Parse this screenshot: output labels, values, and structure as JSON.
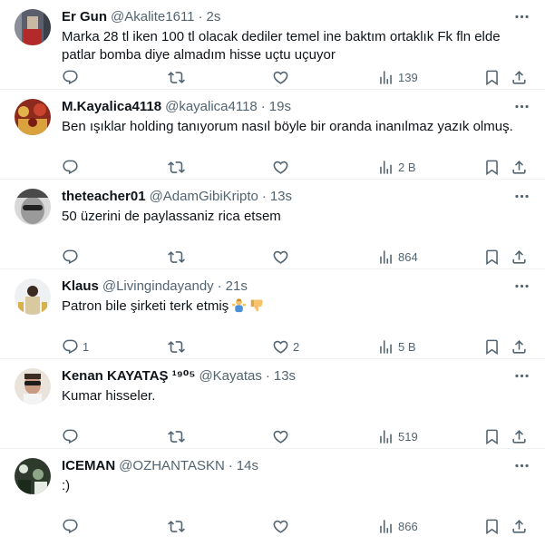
{
  "tweets": [
    {
      "name": "Er Gun",
      "handle": "@Akalite1611",
      "time": "2s",
      "text": "Marka 28 tl iken 100 tl olacak dediler temel ine baktım ortaklık Fk fln elde patlar bomba diye almadım hisse uçtu uçuyor",
      "replies": "",
      "retweets": "",
      "likes": "",
      "views": "139",
      "avatar_color": "#5a5f6b"
    },
    {
      "name": "M.Kayalica4118",
      "handle": "@kayalica4118",
      "time": "19s",
      "text": "Ben ışıklar holding tanıyorum nasıl böyle bir oranda inanılmaz yazık olmuş.",
      "replies": "",
      "retweets": "",
      "likes": "",
      "views": "2 B",
      "avatar_color": "#8c2a1e"
    },
    {
      "name": "theteacher01",
      "handle": "@AdamGibiKripto",
      "time": "13s",
      "text": "50 üzerini de paylassaniz rica etsem",
      "replies": "",
      "retweets": "",
      "likes": "",
      "views": "864",
      "avatar_color": "#9a9a9a"
    },
    {
      "name": "Klaus",
      "handle": "@Livingindayandy",
      "time": "21s",
      "text": "Patron bile şirketi terk etmiş",
      "emoji": [
        "person-shrugging-emoji",
        "thumbs-down-emoji"
      ],
      "replies": "1",
      "retweets": "",
      "likes": "2",
      "views": "5 B",
      "avatar_color": "#d8c9a0"
    },
    {
      "name": "Kenan KAYATAŞ ¹⁹⁰⁵",
      "handle": "@Kayatas",
      "time": "13s",
      "text": "Kumar hisseler.",
      "replies": "",
      "retweets": "",
      "likes": "",
      "views": "519",
      "avatar_color": "#e9e3dc"
    },
    {
      "name": "ICEMAN",
      "handle": "@OZHANTASKN",
      "time": "14s",
      "text": ":)",
      "replies": "",
      "retweets": "",
      "likes": "",
      "views": "866",
      "avatar_color": "#2d3a2c"
    }
  ],
  "colors": {
    "text": "#0f1419",
    "secondary": "#536471",
    "divider": "#eff3f4"
  }
}
